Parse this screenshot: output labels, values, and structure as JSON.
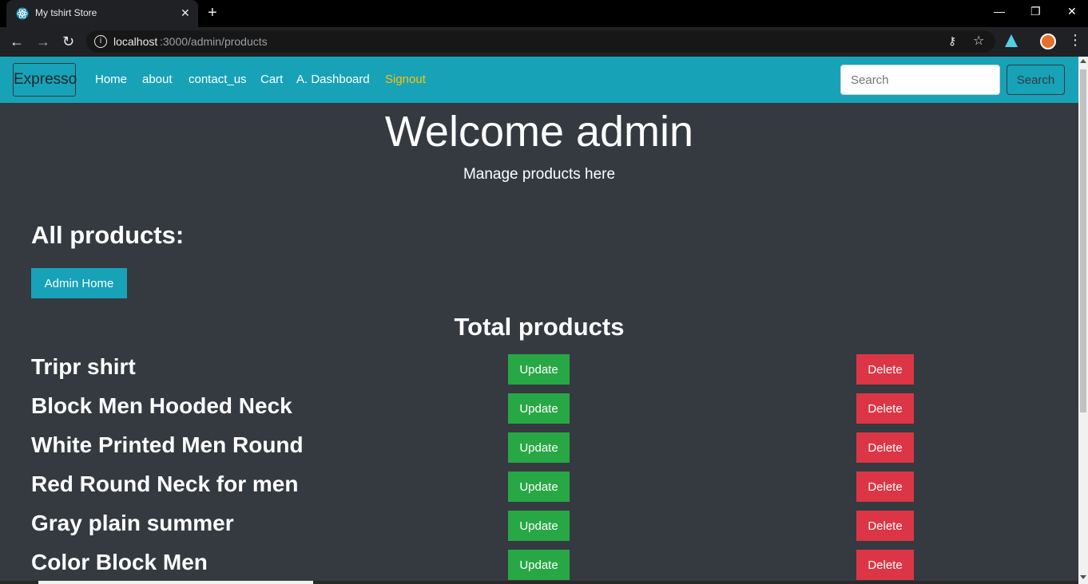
{
  "browser": {
    "tab_title": "My tshirt Store",
    "tab_close": "✕",
    "new_tab": "+",
    "url_host": "localhost",
    "url_path": ":3000/admin/products",
    "minimize": "—",
    "restore": "❐",
    "close": "✕"
  },
  "navbar": {
    "brand": "Expresso",
    "links": [
      "Home",
      "about",
      "contact_us",
      "Cart",
      "A. Dashboard",
      "Signout"
    ],
    "search_placeholder": "Search",
    "search_button": "Search"
  },
  "main": {
    "welcome": "Welcome admin",
    "subtitle": "Manage products here",
    "all_products_heading": "All products:",
    "admin_home_button": "Admin Home",
    "total_products_heading": "Total products",
    "update_label": "Update",
    "delete_label": "Delete",
    "products": [
      "Tripr shirt",
      "Block Men Hooded Neck",
      "White Printed Men Round",
      "Red Round Neck for men",
      "Gray plain summer",
      "Color Block Men"
    ]
  },
  "colors": {
    "navbar": "#17a2b8",
    "background": "#343a40",
    "update": "#28a745",
    "delete": "#dc3545",
    "signout": "#ffc107"
  }
}
